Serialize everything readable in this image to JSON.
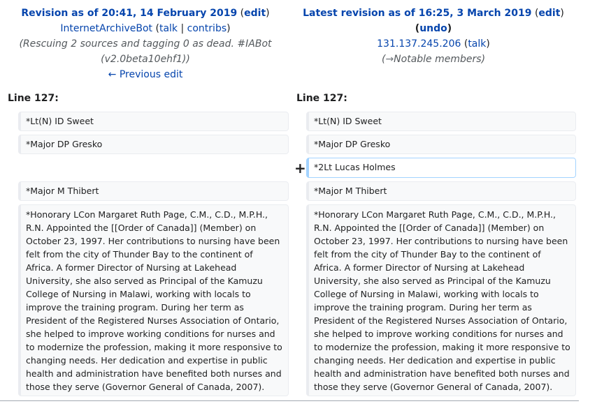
{
  "left_header": {
    "title": "Revision as of 20:41, 14 February 2019",
    "edit_open": "(",
    "edit": "edit",
    "edit_close": ")",
    "user": "InternetArchiveBot",
    "talk_open": "(",
    "talk": "talk",
    "sep": "|",
    "contribs": "contribs",
    "talk_close": ")",
    "summary_line1": "(Rescuing 2 sources and tagging 0 as dead. #IABot",
    "summary_line2": "(v2.0beta10ehf1))",
    "prev_edit": "← Previous edit"
  },
  "right_header": {
    "title": "Latest revision as of 16:25, 3 March 2019",
    "edit_open": "(",
    "edit": "edit",
    "edit_close": ")",
    "undo_open": "(",
    "undo": "undo",
    "undo_close": ")",
    "user": "131.137.245.206",
    "talk_open": "(",
    "talk": "talk",
    "talk_close": ")",
    "summary_open": "(",
    "summary_arrow": "→",
    "summary": "Notable members",
    "summary_close": ")"
  },
  "diff": {
    "left_line": "Line 127:",
    "right_line": "Line 127:",
    "added_marker": "+",
    "rows": {
      "row1": "*Lt(N) ID Sweet",
      "row2": "*Major DP Gresko",
      "added": "*2Lt Lucas Holmes",
      "row3": "*Major M Thibert",
      "row4": "*Honorary LCon Margaret Ruth Page, C.M., C.D., M.P.H., R.N. Appointed the [[Order of Canada]] (Member) on October 23, 1997. Her contributions to nursing have been felt from the city of Thunder Bay to the continent of Africa. A former Director of Nursing at Lakehead University, she also served as Principal of the Kamuzu College of Nursing in Malawi, working with locals to improve the training program. During her term as President of the Registered Nurses Association of Ontario, she helped to improve working conditions for nurses and to modernize the profession, making it more responsive to changing needs. Her dedication and expertise in public health and administration have benefited both nurses and those they serve (Governor General of Canada, 2007)."
    }
  }
}
